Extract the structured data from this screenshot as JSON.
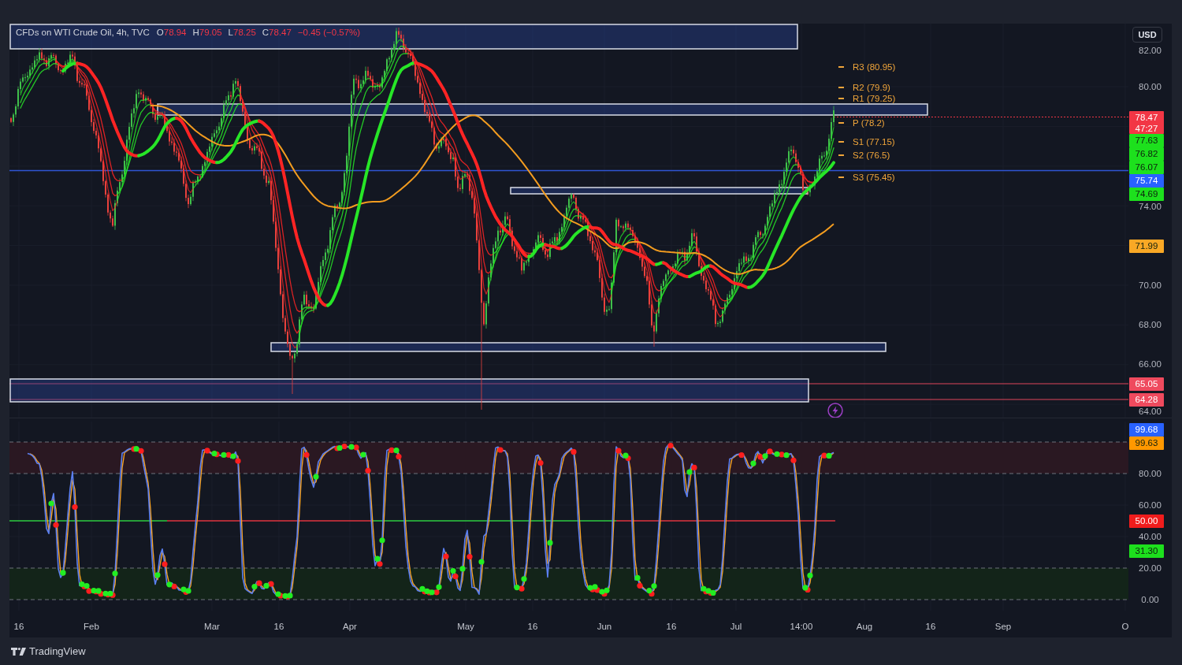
{
  "legend": {
    "title": "CFDs on WTI Crude Oil, 4h, TVC",
    "falling": true,
    "ohlc": [
      {
        "label": "O",
        "value": "78.94"
      },
      {
        "label": "H",
        "value": "79.05"
      },
      {
        "label": "L",
        "value": "78.25"
      },
      {
        "label": "C",
        "value": "78.47"
      }
    ],
    "change": "−0.45 (−0.57%)"
  },
  "pivots": [
    "R3 (80.95)",
    "R2 (79.9)",
    "R1 (79.25)",
    "P (78.2)",
    "S1 (77.15)",
    "S2 (76.5)",
    "S3 (75.45)"
  ],
  "currency_button": "USD",
  "price_axis": {
    "ticks": [
      "82.00",
      "80.00",
      "74.00",
      "70.00",
      "68.00",
      "66.00",
      "64.00"
    ],
    "tags": [
      {
        "text": "78.47",
        "countdown": "47:27",
        "color": "#f23645"
      },
      {
        "text": "77.63",
        "color": "#1de01d"
      },
      {
        "text": "76.82",
        "color": "#1de01d"
      },
      {
        "text": "76.07",
        "color": "#1de01d"
      },
      {
        "text": "75.74",
        "color": "#2962ff"
      },
      {
        "text": "74.69",
        "color": "#1de01d"
      },
      {
        "text": "71.99",
        "color": "#f9a825"
      },
      {
        "text": "65.05",
        "color": "#ef4a5e"
      },
      {
        "text": "64.28",
        "color": "#ef4a5e"
      }
    ]
  },
  "oscillator_axis": {
    "ticks": [
      "80.00",
      "60.00",
      "40.00",
      "20.00",
      "0.00"
    ],
    "tags": [
      {
        "text": "99.68",
        "color": "#2962ff"
      },
      {
        "text": "99.63",
        "color": "#ff9800"
      },
      {
        "text": "50.00",
        "color": "#f01c1c"
      },
      {
        "text": "31.30",
        "color": "#1de01d"
      }
    ]
  },
  "time_axis": [
    "16",
    "Feb",
    "Mar",
    "16",
    "Apr",
    "May",
    "16",
    "Jun",
    "16",
    "Jul",
    "14:00",
    "Aug",
    "16",
    "Sep",
    "O"
  ],
  "footer": {
    "brand": "TradingView"
  }
}
